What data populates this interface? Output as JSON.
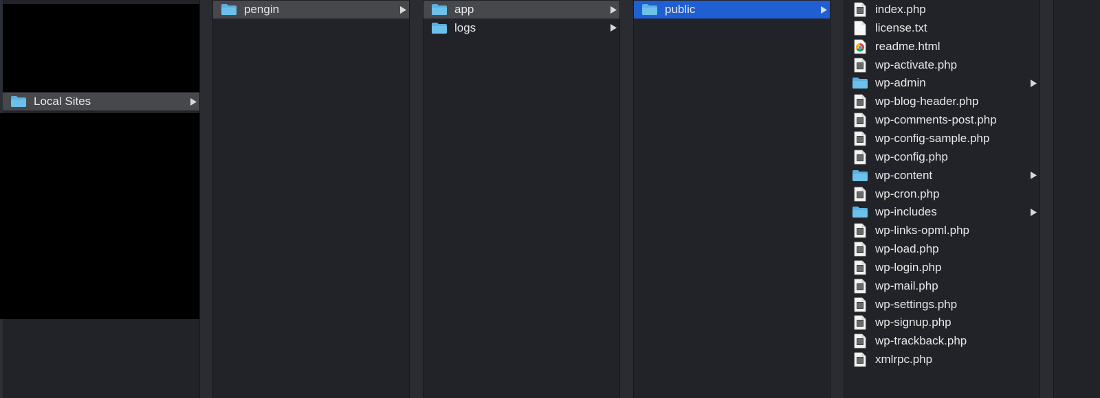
{
  "colors": {
    "background": "#212328",
    "path_highlight": "#46484c",
    "active_highlight": "#1f5fd1",
    "folder": "#5ab0e0",
    "text": "#e8e8e8"
  },
  "column1": {
    "items": [
      {
        "label": "Local Sites",
        "icon": "folder-icon",
        "has_children": true,
        "state": "path"
      }
    ]
  },
  "column2": {
    "items": [
      {
        "label": "pengin",
        "icon": "folder-icon",
        "has_children": true,
        "state": "path"
      }
    ]
  },
  "column3": {
    "items": [
      {
        "label": "app",
        "icon": "folder-icon",
        "has_children": true,
        "state": "path"
      },
      {
        "label": "logs",
        "icon": "folder-icon",
        "has_children": true,
        "state": "none"
      }
    ]
  },
  "column4": {
    "items": [
      {
        "label": "public",
        "icon": "folder-icon",
        "has_children": true,
        "state": "active"
      }
    ]
  },
  "column5": {
    "items": [
      {
        "label": "index.php",
        "icon": "php-file-icon",
        "has_children": false
      },
      {
        "label": "license.txt",
        "icon": "text-file-icon",
        "has_children": false
      },
      {
        "label": "readme.html",
        "icon": "chrome-html-icon",
        "has_children": false
      },
      {
        "label": "wp-activate.php",
        "icon": "php-file-icon",
        "has_children": false
      },
      {
        "label": "wp-admin",
        "icon": "folder-icon",
        "has_children": true
      },
      {
        "label": "wp-blog-header.php",
        "icon": "php-file-icon",
        "has_children": false
      },
      {
        "label": "wp-comments-post.php",
        "icon": "php-file-icon",
        "has_children": false
      },
      {
        "label": "wp-config-sample.php",
        "icon": "php-file-icon",
        "has_children": false
      },
      {
        "label": "wp-config.php",
        "icon": "php-file-icon",
        "has_children": false
      },
      {
        "label": "wp-content",
        "icon": "folder-icon",
        "has_children": true
      },
      {
        "label": "wp-cron.php",
        "icon": "php-file-icon",
        "has_children": false
      },
      {
        "label": "wp-includes",
        "icon": "folder-icon",
        "has_children": true
      },
      {
        "label": "wp-links-opml.php",
        "icon": "php-file-icon",
        "has_children": false
      },
      {
        "label": "wp-load.php",
        "icon": "php-file-icon",
        "has_children": false
      },
      {
        "label": "wp-login.php",
        "icon": "php-file-icon",
        "has_children": false
      },
      {
        "label": "wp-mail.php",
        "icon": "php-file-icon",
        "has_children": false
      },
      {
        "label": "wp-settings.php",
        "icon": "php-file-icon",
        "has_children": false
      },
      {
        "label": "wp-signup.php",
        "icon": "php-file-icon",
        "has_children": false
      },
      {
        "label": "wp-trackback.php",
        "icon": "php-file-icon",
        "has_children": false
      },
      {
        "label": "xmlrpc.php",
        "icon": "php-file-icon",
        "has_children": false
      }
    ]
  }
}
